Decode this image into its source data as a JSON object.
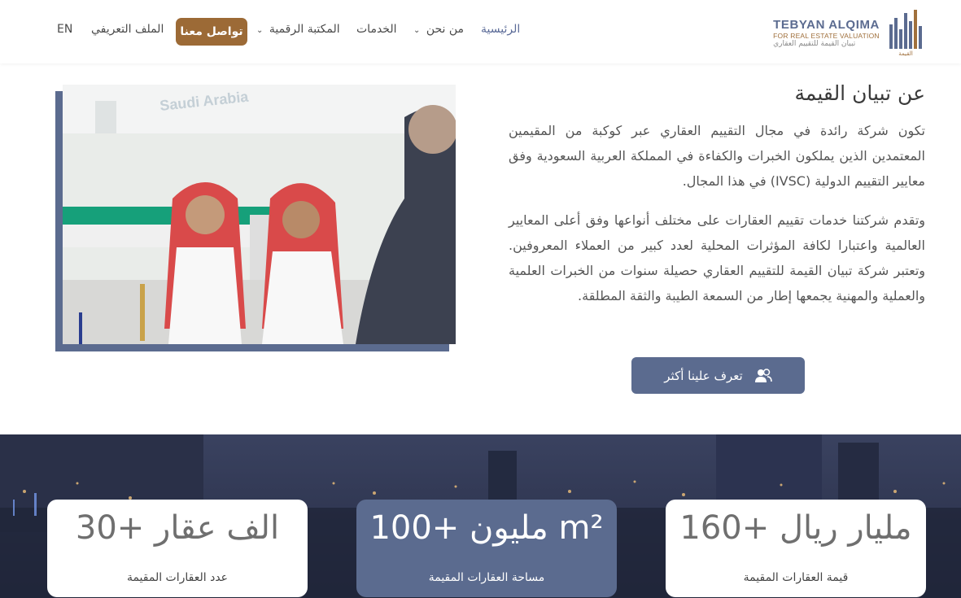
{
  "nav": {
    "lang": "EN",
    "profile": "الملف التعريفي",
    "contact": "تواصل معنا",
    "library": "المكتبة الرقمية",
    "services": "الخدمات",
    "about": "من نحن",
    "home": "الرئيسية",
    "caret": "⌄"
  },
  "logo": {
    "title": "TEBYAN ALQIMA",
    "subtitle": "FOR REAL ESTATE VALUATION",
    "arabic": "تبيان القيمة للتقييم العقاري",
    "mark_text": "القيمة"
  },
  "photo_overlay_text": "Saudi Arabia",
  "about": {
    "title": "عن تبيان القيمة",
    "p1": "تكون شركة رائدة في مجال التقييم العقاري عبر كوكبة من المقيمين المعتمدين الذين يملكون الخبرات والكفاءة في المملكة العربية السعودية وفق معايير التقييم الدولية (IVSC) في هذا المجال.",
    "p2": "وتقدم شركتنا خدمات تقييم العقارات على مختلف أنواعها وفق أعلى المعايير العالمية واعتبارا لكافة المؤثرات المحلية لعدد كبير من العملاء المعروفين. وتعتبر شركة تبيان القيمة للتقييم العقاري حصيلة سنوات من الخبرات العلمية والعملية والمهنية يجمعها إطار من السمعة الطيبة والثقة المطلقة.",
    "button": "تعرف علينا أكثر"
  },
  "stats": [
    {
      "value": "30+ الف عقار",
      "label": "عدد العقارات المقيمة",
      "highlight": false
    },
    {
      "value": "100+ مليون m²",
      "label": "مساحة العقارات المقيمة",
      "highlight": true
    },
    {
      "value": "160+ مليار ريال",
      "label": "قيمة العقارات المقيمة",
      "highlight": false
    }
  ],
  "colors": {
    "brand": "#5b6b8f",
    "accent": "#9c6a36"
  }
}
